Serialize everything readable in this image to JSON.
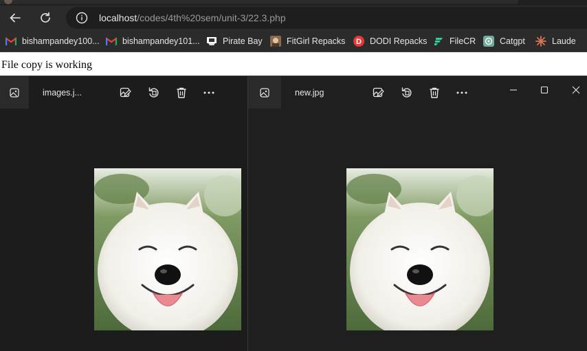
{
  "browser": {
    "url_host": "localhost",
    "url_path": "/codes/4th%20sem/unit-3/22.3.php"
  },
  "bookmarks": [
    {
      "label": "bishampandey100...",
      "icon": "gmail-icon"
    },
    {
      "label": "bishampandey101...",
      "icon": "gmail-icon"
    },
    {
      "label": "Pirate Bay",
      "icon": "pirate-ship-icon"
    },
    {
      "label": "FitGirl Repacks",
      "icon": "fitgirl-avatar-icon"
    },
    {
      "label": "DODI Repacks",
      "icon": "dodi-logo-icon"
    },
    {
      "label": "FileCR",
      "icon": "filecr-logo-icon"
    },
    {
      "label": "Catgpt",
      "icon": "chatgpt-logo-icon"
    },
    {
      "label": "Laude",
      "icon": "claude-star-icon"
    }
  ],
  "page": {
    "message": "File copy is working"
  },
  "viewer_left": {
    "filename": "images.j...",
    "image_subject": "smiling white samoyed dog"
  },
  "viewer_right": {
    "filename": "new.jpg",
    "image_subject": "smiling white samoyed dog"
  },
  "colors": {
    "chrome_bg": "#2b2b2b",
    "viewer_bg": "#1c1c1c",
    "text_light": "#e6e6e6"
  }
}
